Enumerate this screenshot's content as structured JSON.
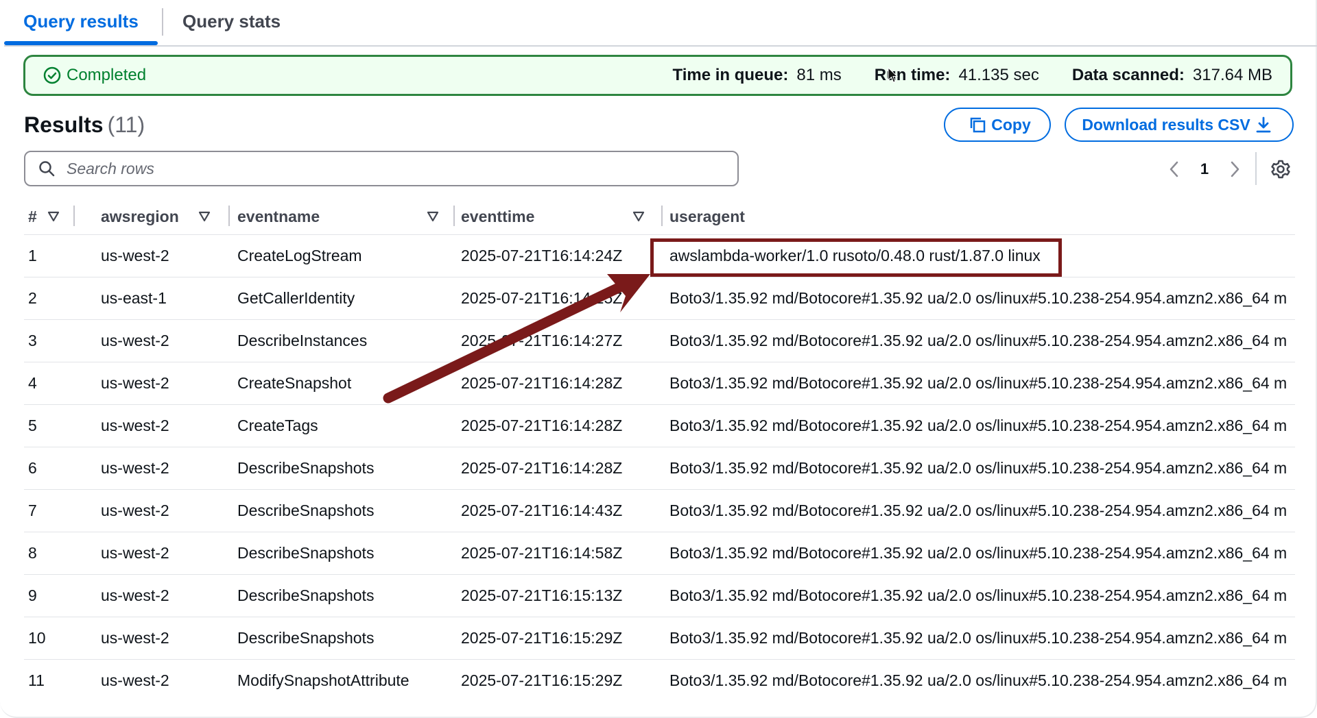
{
  "tabs": [
    "Query results",
    "Query stats"
  ],
  "status": {
    "label": "Completed",
    "time_in_queue_label": "Time in queue:",
    "time_in_queue": "81 ms",
    "run_time_label": "Run time:",
    "run_time": "41.135 sec",
    "data_scanned_label": "Data scanned:",
    "data_scanned": "317.64 MB"
  },
  "results": {
    "title": "Results",
    "count": "(11)"
  },
  "buttons": {
    "copy": "Copy",
    "download": "Download results CSV"
  },
  "search": {
    "placeholder": "Search rows",
    "value": ""
  },
  "pagination": {
    "page": "1"
  },
  "table": {
    "columns": [
      "#",
      "awsregion",
      "eventname",
      "eventtime",
      "useragent"
    ],
    "rows": [
      [
        "1",
        "us-west-2",
        "CreateLogStream",
        "2025-07-21T16:14:24Z",
        "awslambda-worker/1.0 rusoto/0.48.0 rust/1.87.0 linux"
      ],
      [
        "2",
        "us-east-1",
        "GetCallerIdentity",
        "2025-07-21T16:14:25Z",
        "Boto3/1.35.92 md/Botocore#1.35.92 ua/2.0 os/linux#5.10.238-254.954.amzn2.x86_64 m"
      ],
      [
        "3",
        "us-west-2",
        "DescribeInstances",
        "2025-07-21T16:14:27Z",
        "Boto3/1.35.92 md/Botocore#1.35.92 ua/2.0 os/linux#5.10.238-254.954.amzn2.x86_64 m"
      ],
      [
        "4",
        "us-west-2",
        "CreateSnapshot",
        "2025-07-21T16:14:28Z",
        "Boto3/1.35.92 md/Botocore#1.35.92 ua/2.0 os/linux#5.10.238-254.954.amzn2.x86_64 m"
      ],
      [
        "5",
        "us-west-2",
        "CreateTags",
        "2025-07-21T16:14:28Z",
        "Boto3/1.35.92 md/Botocore#1.35.92 ua/2.0 os/linux#5.10.238-254.954.amzn2.x86_64 m"
      ],
      [
        "6",
        "us-west-2",
        "DescribeSnapshots",
        "2025-07-21T16:14:28Z",
        "Boto3/1.35.92 md/Botocore#1.35.92 ua/2.0 os/linux#5.10.238-254.954.amzn2.x86_64 m"
      ],
      [
        "7",
        "us-west-2",
        "DescribeSnapshots",
        "2025-07-21T16:14:43Z",
        "Boto3/1.35.92 md/Botocore#1.35.92 ua/2.0 os/linux#5.10.238-254.954.amzn2.x86_64 m"
      ],
      [
        "8",
        "us-west-2",
        "DescribeSnapshots",
        "2025-07-21T16:14:58Z",
        "Boto3/1.35.92 md/Botocore#1.35.92 ua/2.0 os/linux#5.10.238-254.954.amzn2.x86_64 m"
      ],
      [
        "9",
        "us-west-2",
        "DescribeSnapshots",
        "2025-07-21T16:15:13Z",
        "Boto3/1.35.92 md/Botocore#1.35.92 ua/2.0 os/linux#5.10.238-254.954.amzn2.x86_64 m"
      ],
      [
        "10",
        "us-west-2",
        "DescribeSnapshots",
        "2025-07-21T16:15:29Z",
        "Boto3/1.35.92 md/Botocore#1.35.92 ua/2.0 os/linux#5.10.238-254.954.amzn2.x86_64 m"
      ],
      [
        "11",
        "us-west-2",
        "ModifySnapshotAttribute",
        "2025-07-21T16:15:29Z",
        "Boto3/1.35.92 md/Botocore#1.35.92 ua/2.0 os/linux#5.10.238-254.954.amzn2.x86_64 m"
      ]
    ]
  },
  "colors": {
    "accent": "#006ce0",
    "success": "#00802f",
    "annotation": "#7a1a1a"
  },
  "icons": [
    "check-circle-icon",
    "copy-icon",
    "download-icon",
    "search-icon",
    "chevron-left-icon",
    "chevron-right-icon",
    "gear-icon",
    "sort-icon",
    "cursor-icon",
    "arrow-annotation"
  ]
}
